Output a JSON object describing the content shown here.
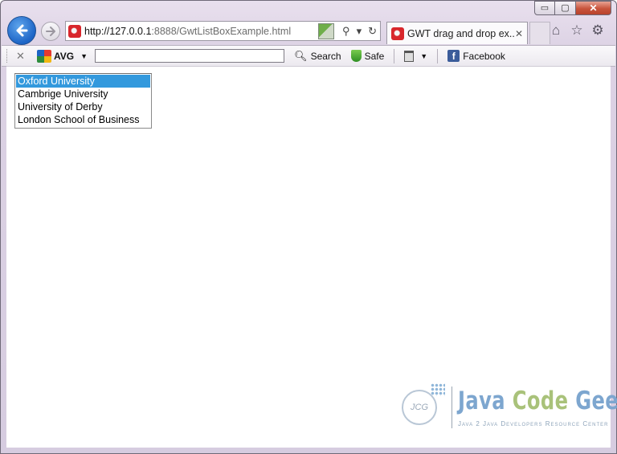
{
  "window": {
    "caption_buttons": {
      "minimize": "▭",
      "maximize": "▢",
      "close": "✕"
    }
  },
  "nav": {
    "back_icon": "arrow-left",
    "forward_icon": "arrow-right",
    "address": {
      "host": "http://127.0.0.1",
      "rest": ":8888/GwtListBoxExample.html"
    },
    "address_tools": {
      "search_glyph": "⚲",
      "dropdown_glyph": "▾",
      "refresh_glyph": "↻"
    },
    "tab": {
      "title": "GWT drag and drop ex...",
      "close_glyph": "✕"
    },
    "right_icons": {
      "home": "⌂",
      "favorites": "☆",
      "settings": "⚙"
    }
  },
  "toolbar": {
    "close_glyph": "✕",
    "avg_label": "AVG",
    "dropdown_glyph": "▼",
    "search_label": "Search",
    "safe_label": "Safe",
    "facebook_label": "Facebook",
    "search_value": ""
  },
  "listbox": {
    "options": [
      {
        "label": "Oxford University",
        "selected": true
      },
      {
        "label": "Cambrige University",
        "selected": false
      },
      {
        "label": "University of Derby",
        "selected": false
      },
      {
        "label": "London School of Business",
        "selected": false
      }
    ],
    "selected_color": "#3399dd"
  },
  "watermark": {
    "logo_text": "JCG",
    "title_java": "Java ",
    "title_code": "Code ",
    "title_geeks": "Geeks",
    "tagline": "Java 2 Java Developers Resource Center"
  },
  "colors": {
    "accent": "#1c64c6",
    "frame": "#dcd2e4"
  }
}
